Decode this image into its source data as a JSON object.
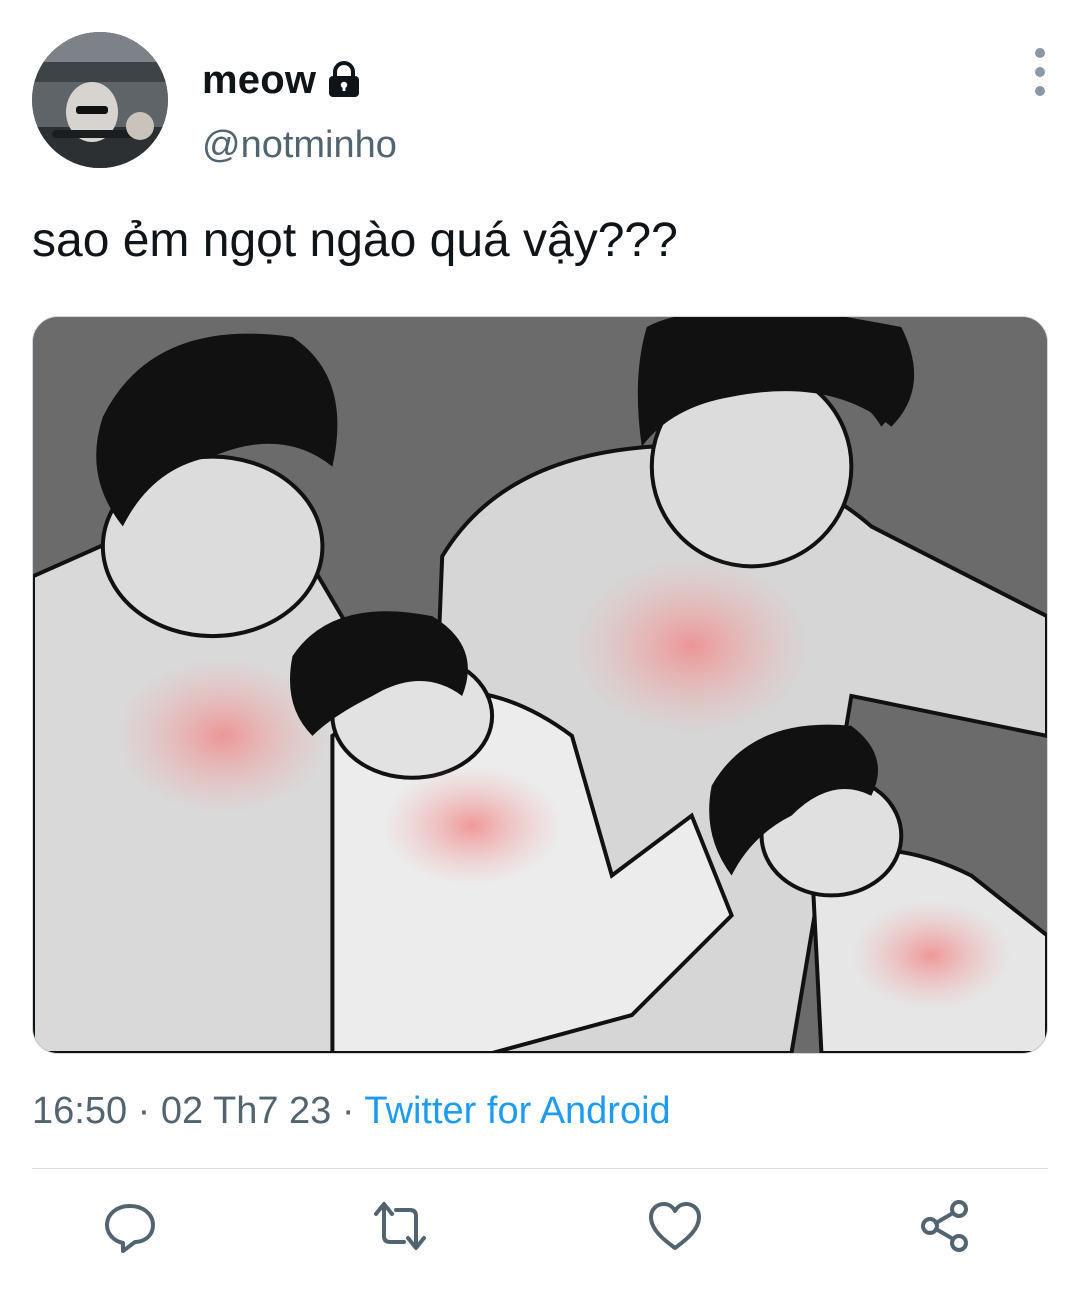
{
  "author": {
    "display_name": "meow",
    "username": "@notminho",
    "protected_icon": "lock-icon",
    "avatar": "avatar"
  },
  "tweet": {
    "text": "sao ẻm ngọt ngào quá vậy???",
    "media": "photo"
  },
  "meta": {
    "time": "16:50",
    "separator": "·",
    "date": "02 Th7 23",
    "source": "Twitter for Android"
  },
  "icons": {
    "more": "more-vertical-icon",
    "reply": "reply-icon",
    "retweet": "retweet-icon",
    "like": "heart-icon",
    "share": "share-icon"
  },
  "colors": {
    "text": "#0f1419",
    "secondary": "#536471",
    "link": "#1d9bf0",
    "icon": "#536471",
    "divider": "#d9dfe3"
  }
}
